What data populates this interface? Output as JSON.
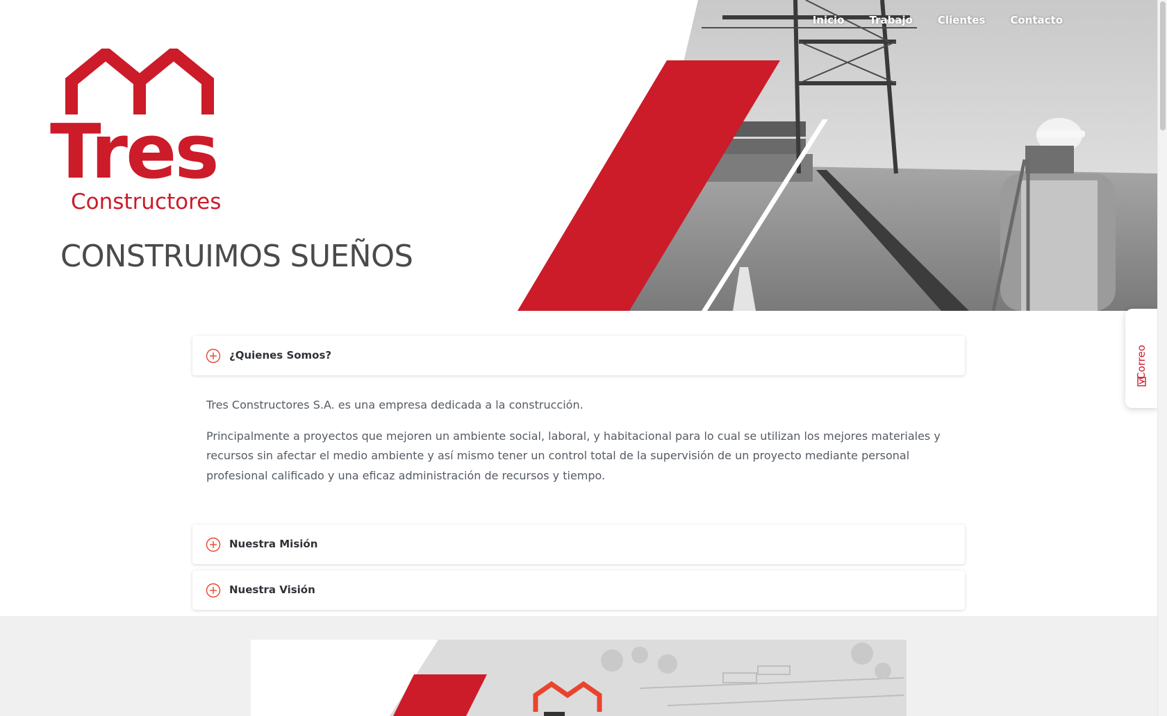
{
  "nav": {
    "items": [
      {
        "label": "Inicio"
      },
      {
        "label": "Trabajo"
      },
      {
        "label": "Clientes"
      },
      {
        "label": "Contacto"
      }
    ]
  },
  "hero": {
    "logo_word": "Tres",
    "logo_sub": "Constructores",
    "tagline": "CONSTRUIMOS SUEÑOS"
  },
  "side_tab": {
    "label": "Correo",
    "icon": "mail-icon"
  },
  "accordion": {
    "items": [
      {
        "title": "¿Quienes Somos?",
        "icon": "plus-circle-icon",
        "expanded": true
      },
      {
        "title": "Nuestra Misión",
        "icon": "plus-circle-icon",
        "expanded": false
      },
      {
        "title": "Nuestra Visión",
        "icon": "plus-circle-icon",
        "expanded": false
      }
    ],
    "body": {
      "paragraph_1": "Tres Constructores S.A. es una empresa dedicada a la construcción.",
      "paragraph_2": "Principalmente a proyectos que mejoren un ambiente social, laboral, y habitacional para lo cual se utilizan los mejores materiales y recursos sin afectar el medio ambiente y así mismo tener un control total de la supervisión de un proyecto mediante personal profesional calificado y una eficaz administración de recursos y tiempo."
    }
  },
  "colors": {
    "brand_red": "#cc1b29",
    "accent_orange": "#e8442e",
    "text_dark": "#2f3237",
    "text_body": "#555b63"
  }
}
